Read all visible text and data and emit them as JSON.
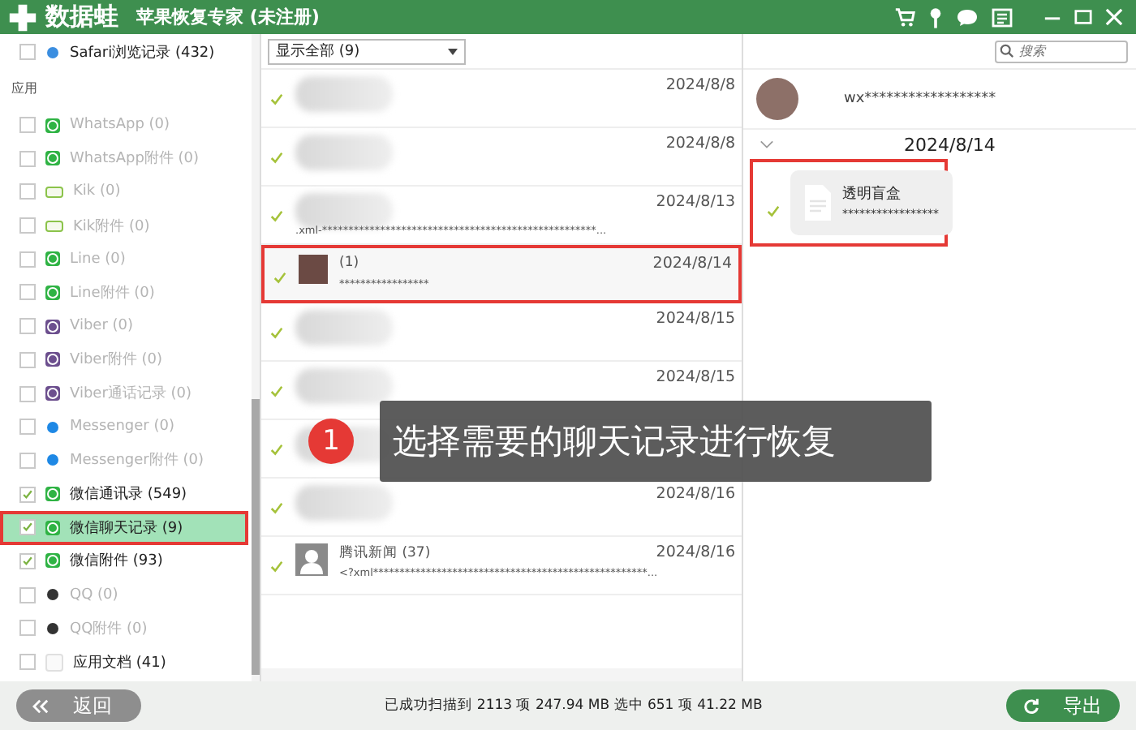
{
  "window": {
    "logo_text": "数据蛙",
    "title": "苹果恢复专家 (未注册)"
  },
  "sidebar": {
    "top_item": {
      "label": "Safari浏览记录 (432)",
      "checked": false,
      "kind": "safari"
    },
    "section_label": "应用",
    "items": [
      {
        "label": "WhatsApp (0)",
        "kind": "whatsapp",
        "checked": false,
        "disabled": true,
        "selected": false
      },
      {
        "label": "WhatsApp附件 (0)",
        "kind": "whatsapp",
        "checked": false,
        "disabled": true,
        "selected": false
      },
      {
        "label": "Kik (0)",
        "kind": "kik",
        "checked": false,
        "disabled": true,
        "selected": false
      },
      {
        "label": "Kik附件 (0)",
        "kind": "kik",
        "checked": false,
        "disabled": true,
        "selected": false
      },
      {
        "label": "Line (0)",
        "kind": "line",
        "checked": false,
        "disabled": true,
        "selected": false
      },
      {
        "label": "Line附件 (0)",
        "kind": "line",
        "checked": false,
        "disabled": true,
        "selected": false
      },
      {
        "label": "Viber (0)",
        "kind": "viber",
        "checked": false,
        "disabled": true,
        "selected": false
      },
      {
        "label": "Viber附件 (0)",
        "kind": "viber",
        "checked": false,
        "disabled": true,
        "selected": false
      },
      {
        "label": "Viber通话记录 (0)",
        "kind": "viber",
        "checked": false,
        "disabled": true,
        "selected": false
      },
      {
        "label": "Messenger (0)",
        "kind": "messenger",
        "checked": false,
        "disabled": true,
        "selected": false
      },
      {
        "label": "Messenger附件 (0)",
        "kind": "messenger",
        "checked": false,
        "disabled": true,
        "selected": false
      },
      {
        "label": "微信通讯录 (549)",
        "kind": "wechat",
        "checked": true,
        "disabled": false,
        "selected": false
      },
      {
        "label": "微信聊天记录 (9)",
        "kind": "wechat",
        "checked": true,
        "disabled": false,
        "selected": true
      },
      {
        "label": "微信附件 (93)",
        "kind": "wechat",
        "checked": true,
        "disabled": false,
        "selected": false
      },
      {
        "label": "QQ (0)",
        "kind": "qq",
        "checked": false,
        "disabled": true,
        "selected": false
      },
      {
        "label": "QQ附件 (0)",
        "kind": "qq",
        "checked": false,
        "disabled": true,
        "selected": false
      },
      {
        "label": "应用文档 (41)",
        "kind": "doc",
        "checked": false,
        "disabled": false,
        "selected": false
      }
    ]
  },
  "filter": {
    "value": "显示全部 (9)"
  },
  "search": {
    "placeholder": "搜索"
  },
  "conversations": [
    {
      "kind": "blurred",
      "date": "2024/8/8",
      "checked": true,
      "selected": false
    },
    {
      "kind": "blurred",
      "date": "2024/8/8",
      "checked": true,
      "selected": false
    },
    {
      "kind": "blurred",
      "preview": ".xml-****************************************************...",
      "date": "2024/8/13",
      "checked": true,
      "selected": false
    },
    {
      "kind": "photo",
      "name": "(1)",
      "preview": "*****************",
      "date": "2024/8/14",
      "checked": true,
      "selected": true
    },
    {
      "kind": "blurred",
      "date": "2024/8/15",
      "checked": true,
      "selected": false
    },
    {
      "kind": "blurred",
      "date": "2024/8/15",
      "checked": true,
      "selected": false
    },
    {
      "kind": "blurred",
      "checked": true,
      "selected": false
    },
    {
      "kind": "blurred",
      "date": "2024/8/16",
      "checked": true,
      "selected": false
    },
    {
      "kind": "generic",
      "name": "腾讯新闻 (37)",
      "preview": "<?xml****************************************************...",
      "date": "2024/8/16",
      "checked": true,
      "selected": false
    }
  ],
  "chat": {
    "contact": "wx******************",
    "date": "2024/8/14",
    "messages": [
      {
        "title": "透明盲盒",
        "text": "*****************",
        "checked": true,
        "highlighted": true
      }
    ]
  },
  "callout": {
    "number": "1",
    "text": "选择需要的聊天记录进行恢复"
  },
  "footer": {
    "back_button": "返回",
    "status": "已成功扫描到 2113 项 247.94 MB  选中 651 项 41.22 MB",
    "export_button": "导出"
  }
}
